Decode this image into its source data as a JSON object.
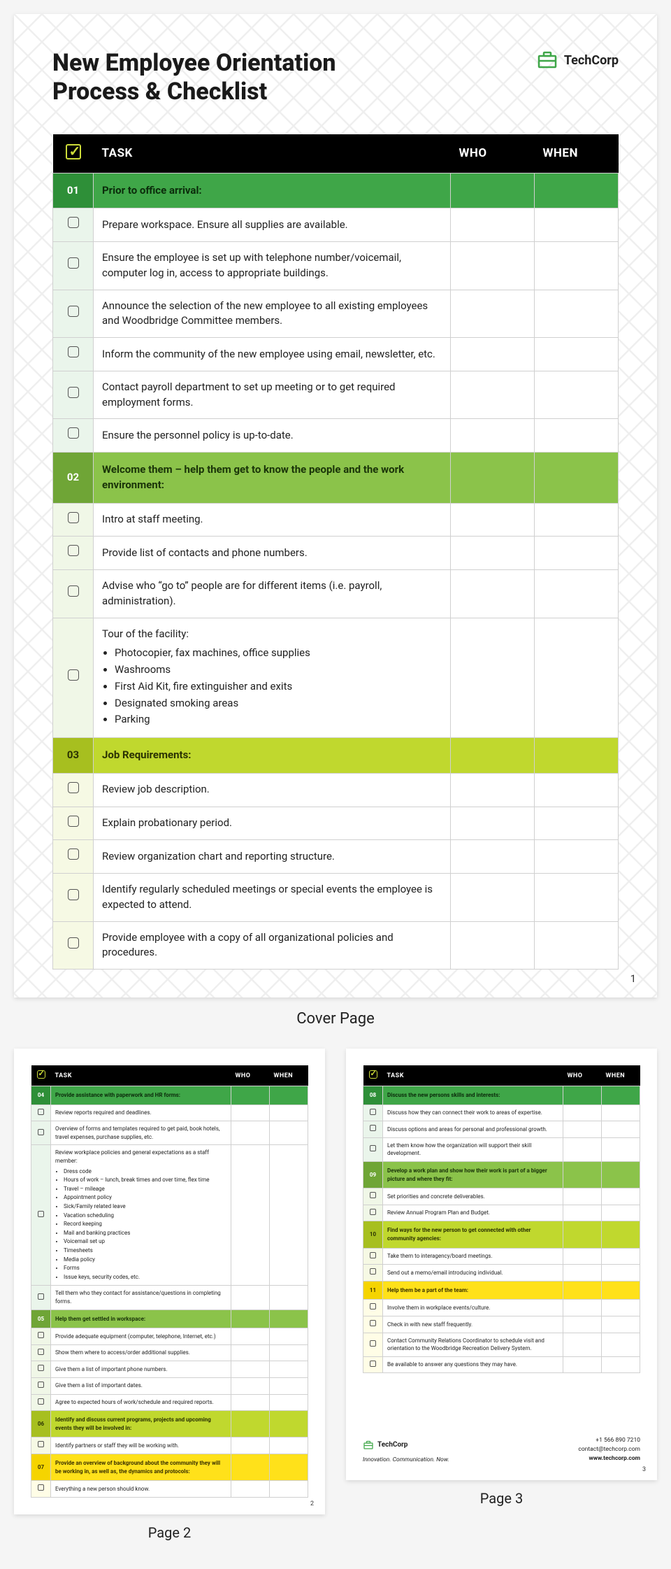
{
  "title": "New Employee Orientation Process & Checklist",
  "brand": "TechCorp",
  "caption_cover": "Cover Page",
  "caption_p2": "Page 2",
  "caption_p3": "Page 3",
  "columns": {
    "task": "TASK",
    "who": "WHO",
    "when": "WHEN"
  },
  "pageNumbers": {
    "p1": "1",
    "p2": "2",
    "p3": "3"
  },
  "footer": {
    "tagline": "Innovation. Communication. Now.",
    "phone": "+1 566 890 7210",
    "email": "contact@techcorp.com",
    "site": "www.techcorp.com"
  },
  "sections_p1": [
    {
      "num": "01",
      "cls": "sec-green",
      "tint": "tint-green",
      "heading": "Prior to office arrival:",
      "rows": [
        {
          "text": "Prepare workspace. Ensure all supplies are available."
        },
        {
          "text": "Ensure the employee is set up with telephone number/voicemail, computer log in, access to appropriate buildings."
        },
        {
          "text": "Announce the selection of the new employee to all existing employees and Woodbridge Committee members."
        },
        {
          "text": "Inform the community of the new employee using email, newsletter, etc."
        },
        {
          "text": "Contact payroll department to set up meeting or to get required employment forms."
        },
        {
          "text": "Ensure the personnel policy is up-to-date."
        }
      ]
    },
    {
      "num": "02",
      "cls": "sec-lime",
      "tint": "tint-lime",
      "heading": "Welcome them – help them get to know the people and the work environment:",
      "rows": [
        {
          "text": "Intro at staff meeting."
        },
        {
          "text": "Provide list of contacts and phone numbers."
        },
        {
          "text": "Advise who “go to” people are for different items (i.e. payroll, administration)."
        },
        {
          "text": "Tour of the facility:",
          "bullets": [
            "Photocopier, fax machines, office supplies",
            "Washrooms",
            "First Aid Kit, fire extinguisher and exits",
            "Designated smoking areas",
            "Parking"
          ]
        }
      ]
    },
    {
      "num": "03",
      "cls": "sec-yellowgreen",
      "tint": "tint-ygreen",
      "heading": "Job Requirements:",
      "rows": [
        {
          "text": "Review job description."
        },
        {
          "text": "Explain probationary period."
        },
        {
          "text": "Review organization chart and reporting structure."
        },
        {
          "text": "Identify regularly scheduled meetings or special events the employee is expected to attend."
        },
        {
          "text": "Provide employee with a copy of all organizational policies and procedures."
        }
      ]
    }
  ],
  "sections_p2": [
    {
      "num": "04",
      "cls": "sec-green",
      "tint": "tint-green",
      "heading": "Provide assistance with paperwork and HR forms:",
      "rows": [
        {
          "text": "Review reports required and deadlines."
        },
        {
          "text": "Overview of forms and templates required to get paid, book hotels, travel expenses, purchase supplies, etc."
        },
        {
          "text": "Review workplace policies and general expectations as a staff member:",
          "bullets": [
            "Dress code",
            "Hours of work – lunch, break times and over time, flex time",
            "Travel – mileage",
            "Appointment policy",
            "Sick/Family related leave",
            "Vacation scheduling",
            "Record keeping",
            "Mail and banking practices",
            "Voicemail set up",
            "Timesheets",
            "Media policy",
            "Forms",
            "Issue keys, security codes, etc."
          ]
        },
        {
          "text": "Tell them who they contact for assistance/questions in completing forms."
        }
      ]
    },
    {
      "num": "05",
      "cls": "sec-lime",
      "tint": "tint-lime",
      "heading": "Help them get settled in workspace:",
      "rows": [
        {
          "text": "Provide adequate equipment (computer, telephone, Internet, etc.)"
        },
        {
          "text": "Show them where to access/order additional supplies."
        },
        {
          "text": "Give them a list of important phone numbers."
        },
        {
          "text": "Give them a list of important dates."
        },
        {
          "text": "Agree to expected hours of work/schedule and required reports."
        }
      ]
    },
    {
      "num": "06",
      "cls": "sec-yellowgreen",
      "tint": "tint-ygreen",
      "heading": "Identify and discuss current programs, projects and upcoming events they will be involved in:",
      "rows": [
        {
          "text": "Identify partners or staff they will be working with."
        }
      ]
    },
    {
      "num": "07",
      "cls": "sec-yellow",
      "tint": "tint-yellow",
      "heading": "Provide an overview of background about the community they will be working in, as well as, the dynamics and protocols:",
      "rows": [
        {
          "text": "Everything a new person should know."
        }
      ]
    }
  ],
  "sections_p3": [
    {
      "num": "08",
      "cls": "sec-green",
      "tint": "tint-green",
      "heading": "Discuss the new persons skills and interests:",
      "rows": [
        {
          "text": "Discuss how they can connect their work to areas of expertise."
        },
        {
          "text": "Discuss options and areas for personal and professional growth."
        },
        {
          "text": "Let them know how the organization will support their skill development."
        }
      ]
    },
    {
      "num": "09",
      "cls": "sec-lime",
      "tint": "tint-lime",
      "heading": "Develop a work plan and show how their work is part of a bigger picture and where they fit:",
      "rows": [
        {
          "text": "Set priorities and concrete deliverables."
        },
        {
          "text": "Review Annual Program Plan and Budget."
        }
      ]
    },
    {
      "num": "10",
      "cls": "sec-yellowgreen",
      "tint": "tint-ygreen",
      "heading": "Find ways for the new person to get connected with other community agencies:",
      "rows": [
        {
          "text": "Take them to interagency/board meetings."
        },
        {
          "text": "Send out a memo/email introducing individual."
        }
      ]
    },
    {
      "num": "11",
      "cls": "sec-yellow",
      "tint": "tint-yellow",
      "heading": "Help them be a part of the team:",
      "rows": [
        {
          "text": "Involve them in workplace events/culture."
        },
        {
          "text": "Check in with new staff frequently."
        },
        {
          "text": "Contact Community Relations Coordinator to schedule visit and orientation to the Woodbridge Recreation Delivery System."
        },
        {
          "text": "Be available to answer any questions they may have."
        }
      ]
    }
  ]
}
